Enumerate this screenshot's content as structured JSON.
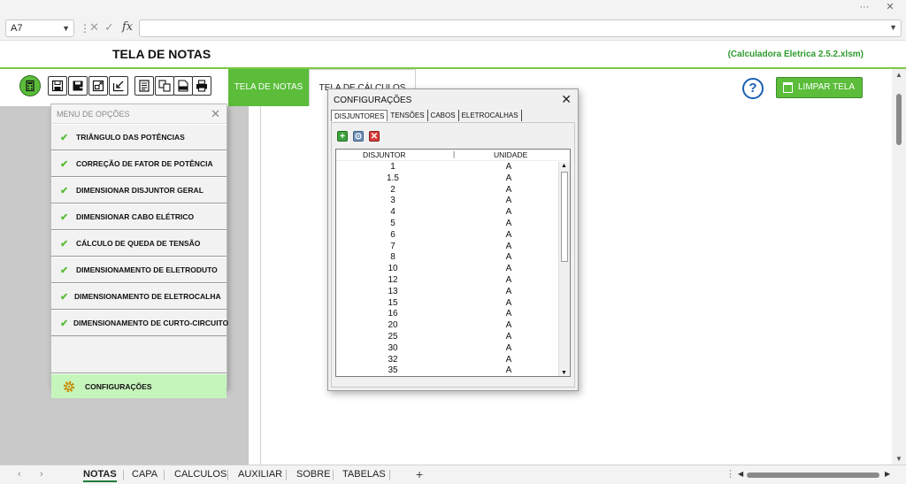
{
  "window": {
    "more_icon": "more-icon",
    "close_label": "✕",
    "more_label": "···"
  },
  "formula_bar": {
    "name_box": "A7",
    "fx_label": "fx"
  },
  "header": {
    "title": "TELA DE NOTAS",
    "file_name": "(Calculadora Eletrica 2.5.2.xlsm)"
  },
  "toolbar": {
    "tab_notas": "TELA DE NOTAS",
    "tab_calculos": "TELA DE CÁLCULOS",
    "help_label": "?",
    "clear_label": "LIMPAR TELA"
  },
  "menu": {
    "title": "MENU DE OPÇÕES",
    "items": [
      {
        "label": "TRIÂNGULO DAS POTÊNCIAS"
      },
      {
        "label": "CORREÇÃO DE FATOR DE POTÊNCIA"
      },
      {
        "label": "DIMENSIONAR DISJUNTOR GERAL"
      },
      {
        "label": "DIMENSIONAR CABO ELÉTRICO"
      },
      {
        "label": "CÁLCULO DE QUEDA DE TENSÃO"
      },
      {
        "label": "DIMENSIONAMENTO DE ELETRODUTO"
      },
      {
        "label": "DIMENSIONAMENTO DE ELETROCALHA"
      },
      {
        "label": "DIMENSIONAMENTO DE CURTO-CIRCUITO"
      }
    ],
    "config_label": "CONFIGURAÇÕES"
  },
  "dialog": {
    "title": "CONFIGURAÇÕES",
    "tabs": [
      "DISJUNTORES",
      "TENSÕES",
      "CABOS",
      "ELETROCALHAS"
    ],
    "columns": [
      "DISJUNTOR",
      "UNIDADE"
    ],
    "rows": [
      {
        "value": "1",
        "unit": "A"
      },
      {
        "value": "1.5",
        "unit": "A"
      },
      {
        "value": "2",
        "unit": "A"
      },
      {
        "value": "3",
        "unit": "A"
      },
      {
        "value": "4",
        "unit": "A"
      },
      {
        "value": "5",
        "unit": "A"
      },
      {
        "value": "6",
        "unit": "A"
      },
      {
        "value": "7",
        "unit": "A"
      },
      {
        "value": "8",
        "unit": "A"
      },
      {
        "value": "10",
        "unit": "A"
      },
      {
        "value": "12",
        "unit": "A"
      },
      {
        "value": "13",
        "unit": "A"
      },
      {
        "value": "15",
        "unit": "A"
      },
      {
        "value": "16",
        "unit": "A"
      },
      {
        "value": "20",
        "unit": "A"
      },
      {
        "value": "25",
        "unit": "A"
      },
      {
        "value": "30",
        "unit": "A"
      },
      {
        "value": "32",
        "unit": "A"
      },
      {
        "value": "35",
        "unit": "A"
      }
    ]
  },
  "sheets": {
    "tabs": [
      "NOTAS",
      "CAPA",
      "CALCULOS",
      "AUXILIAR",
      "SOBRE",
      "TABELAS"
    ],
    "active": "NOTAS",
    "add_label": "+"
  },
  "colors": {
    "accent_green": "#5bbd3a",
    "config_bg": "#c6f5bc",
    "file_name": "#2e9b2e"
  }
}
